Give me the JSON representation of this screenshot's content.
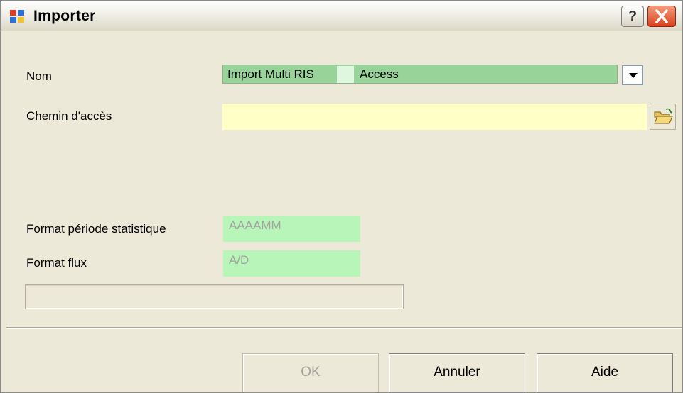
{
  "window": {
    "title": "Importer",
    "help_label": "?",
    "icons": {
      "app": "app-window-icon",
      "close": "close-icon",
      "browse": "folder-open-icon"
    },
    "close_color": "#d8411c"
  },
  "form": {
    "nom_label": "Nom",
    "nom_value_part1": "Import Multi RIS",
    "nom_value_part2": "Access",
    "chemin_label": "Chemin d'accès",
    "chemin_value": "",
    "format_periode_label": "Format période statistique",
    "format_periode_value": "AAAAMM",
    "format_flux_label": "Format flux",
    "format_flux_value": "A/D"
  },
  "colors": {
    "combo_bg": "#98d49a",
    "path_bg": "#ffffc6",
    "readonly_bg": "#b8f5b8",
    "dialog_bg": "#ece9d8"
  },
  "buttons": {
    "ok": "OK",
    "cancel": "Annuler",
    "help": "Aide"
  }
}
